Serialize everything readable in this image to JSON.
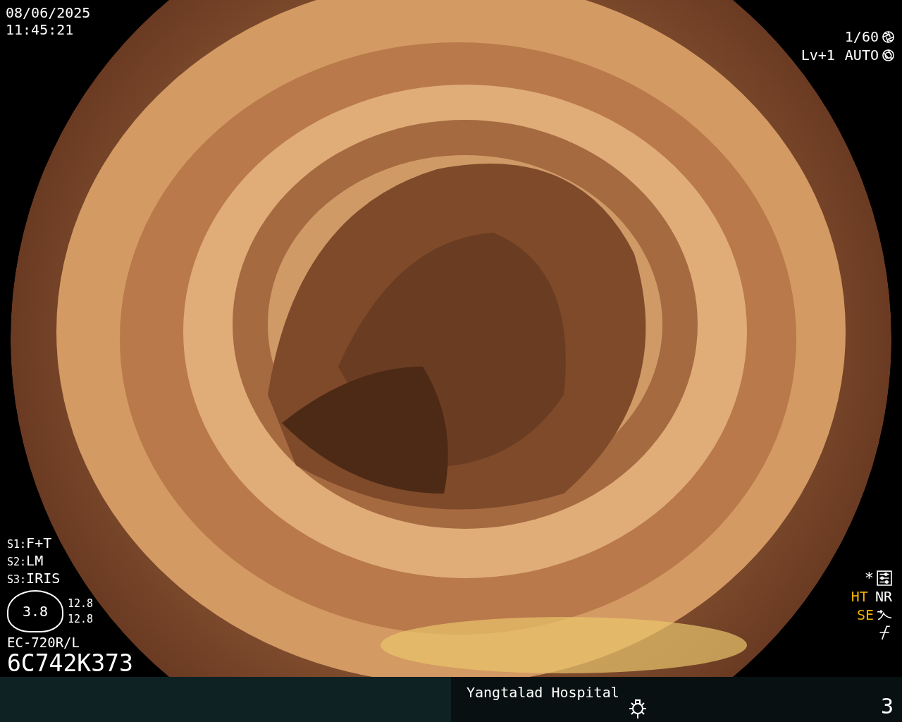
{
  "timestamp": {
    "date": "08/06/2025",
    "time": "11:45:21"
  },
  "exposure": {
    "shutter": "1/60",
    "level": "Lv+1",
    "mode": "AUTO"
  },
  "switches": [
    {
      "label": "S1:",
      "value": "F+T"
    },
    {
      "label": "S2:",
      "value": "LM"
    },
    {
      "label": "S3:",
      "value": "IRIS"
    }
  ],
  "scope_gauge": {
    "center": "3.8",
    "readings": [
      "12.8",
      "12.8"
    ]
  },
  "scope": {
    "model": "EC-720R/L",
    "serial": "6C742K373"
  },
  "settings_mark": "*",
  "enhancements": [
    {
      "label": "HT",
      "on": true
    },
    {
      "label": "NR",
      "on": false
    },
    {
      "label": "SE",
      "on": true
    }
  ],
  "bottom_bar": {
    "hospital": "Yangtalad Hospital",
    "count": "3"
  }
}
